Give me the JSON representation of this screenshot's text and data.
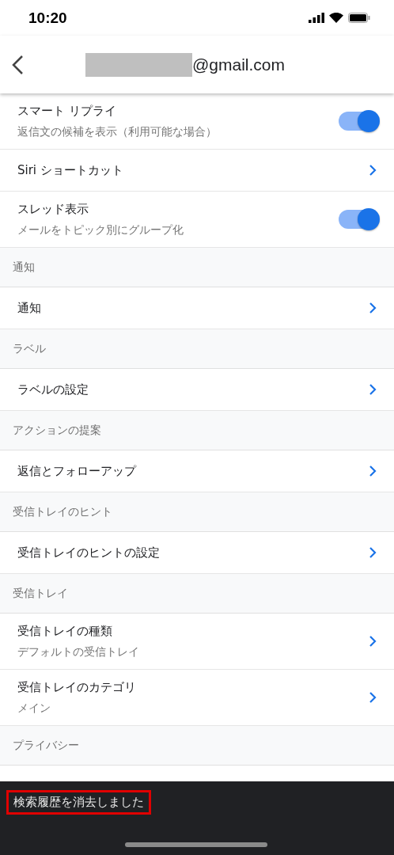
{
  "status_bar": {
    "time": "10:20"
  },
  "header": {
    "title": "@gmail.com"
  },
  "items": [
    {
      "kind": "toggle",
      "label": "スマート リプライ",
      "subtitle": "返信文の候補を表示（利用可能な場合）",
      "on": true
    },
    {
      "kind": "link",
      "label": "Siri ショートカット"
    },
    {
      "kind": "toggle",
      "label": "スレッド表示",
      "subtitle": "メールをトピック別にグループ化",
      "on": true
    },
    {
      "kind": "section",
      "label": "通知"
    },
    {
      "kind": "link",
      "label": "通知"
    },
    {
      "kind": "section",
      "label": "ラベル"
    },
    {
      "kind": "link",
      "label": "ラベルの設定"
    },
    {
      "kind": "section",
      "label": "アクションの提案"
    },
    {
      "kind": "link",
      "label": "返信とフォローアップ"
    },
    {
      "kind": "section",
      "label": "受信トレイのヒント"
    },
    {
      "kind": "link",
      "label": "受信トレイのヒントの設定"
    },
    {
      "kind": "section",
      "label": "受信トレイ"
    },
    {
      "kind": "link",
      "label": "受信トレイの種類",
      "subtitle": "デフォルトの受信トレイ"
    },
    {
      "kind": "link",
      "label": "受信トレイのカテゴリ",
      "subtitle": "メイン"
    },
    {
      "kind": "section",
      "label": "プライバシー"
    }
  ],
  "snackbar": {
    "message": "検索履歴を消去しました"
  }
}
